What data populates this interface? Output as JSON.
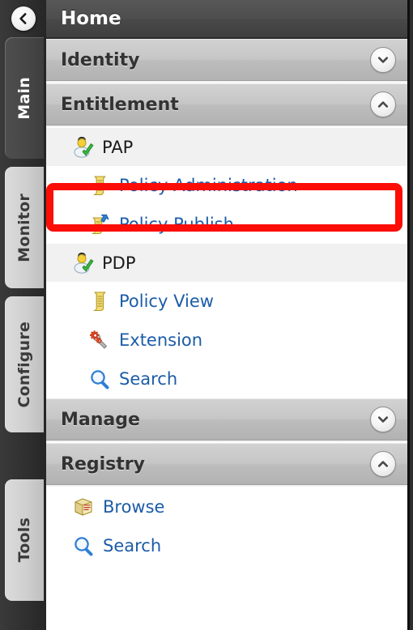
{
  "window": {
    "back_button": "back-arrow",
    "title": "Home"
  },
  "rail": {
    "tabs": [
      {
        "label": "Main",
        "active": true
      },
      {
        "label": "Monitor",
        "active": false
      },
      {
        "label": "Configure",
        "active": false
      },
      {
        "label": "Tools",
        "active": false
      }
    ]
  },
  "sections": {
    "identity": {
      "title": "Identity",
      "state": "collapsed",
      "chevron": "chevron-down-icon"
    },
    "entitlement": {
      "title": "Entitlement",
      "state": "expanded",
      "chevron": "chevron-up-icon"
    },
    "manage": {
      "title": "Manage",
      "state": "collapsed",
      "chevron": "chevron-down-icon"
    },
    "registry": {
      "title": "Registry",
      "state": "expanded",
      "chevron": "chevron-up-icon"
    }
  },
  "entitlement_items": {
    "pap_group": {
      "label": "PAP",
      "icon": "user-check-icon"
    },
    "policy_administration": {
      "label": "Policy Administration",
      "icon": "policy-scroll-icon"
    },
    "policy_publish": {
      "label": "Policy Publish",
      "icon": "policy-publish-icon"
    },
    "pdp_group": {
      "label": "PDP",
      "icon": "user-check-icon"
    },
    "policy_view": {
      "label": "Policy View",
      "icon": "policy-scroll-icon"
    },
    "extension": {
      "label": "Extension",
      "icon": "gear-wrench-icon"
    },
    "search": {
      "label": "Search",
      "icon": "magnifier-icon"
    }
  },
  "registry_items": {
    "browse": {
      "label": "Browse",
      "icon": "book-icon"
    },
    "search": {
      "label": "Search",
      "icon": "magnifier-icon"
    }
  },
  "annotation": {
    "highlight_target": "Policy Administration",
    "highlight_color": "#fc0d08"
  },
  "colors": {
    "link": "#1c5ca8",
    "header_bg": "#4a4a4a",
    "section_bg": "#c3c3c3",
    "rail_bg": "#323232"
  }
}
